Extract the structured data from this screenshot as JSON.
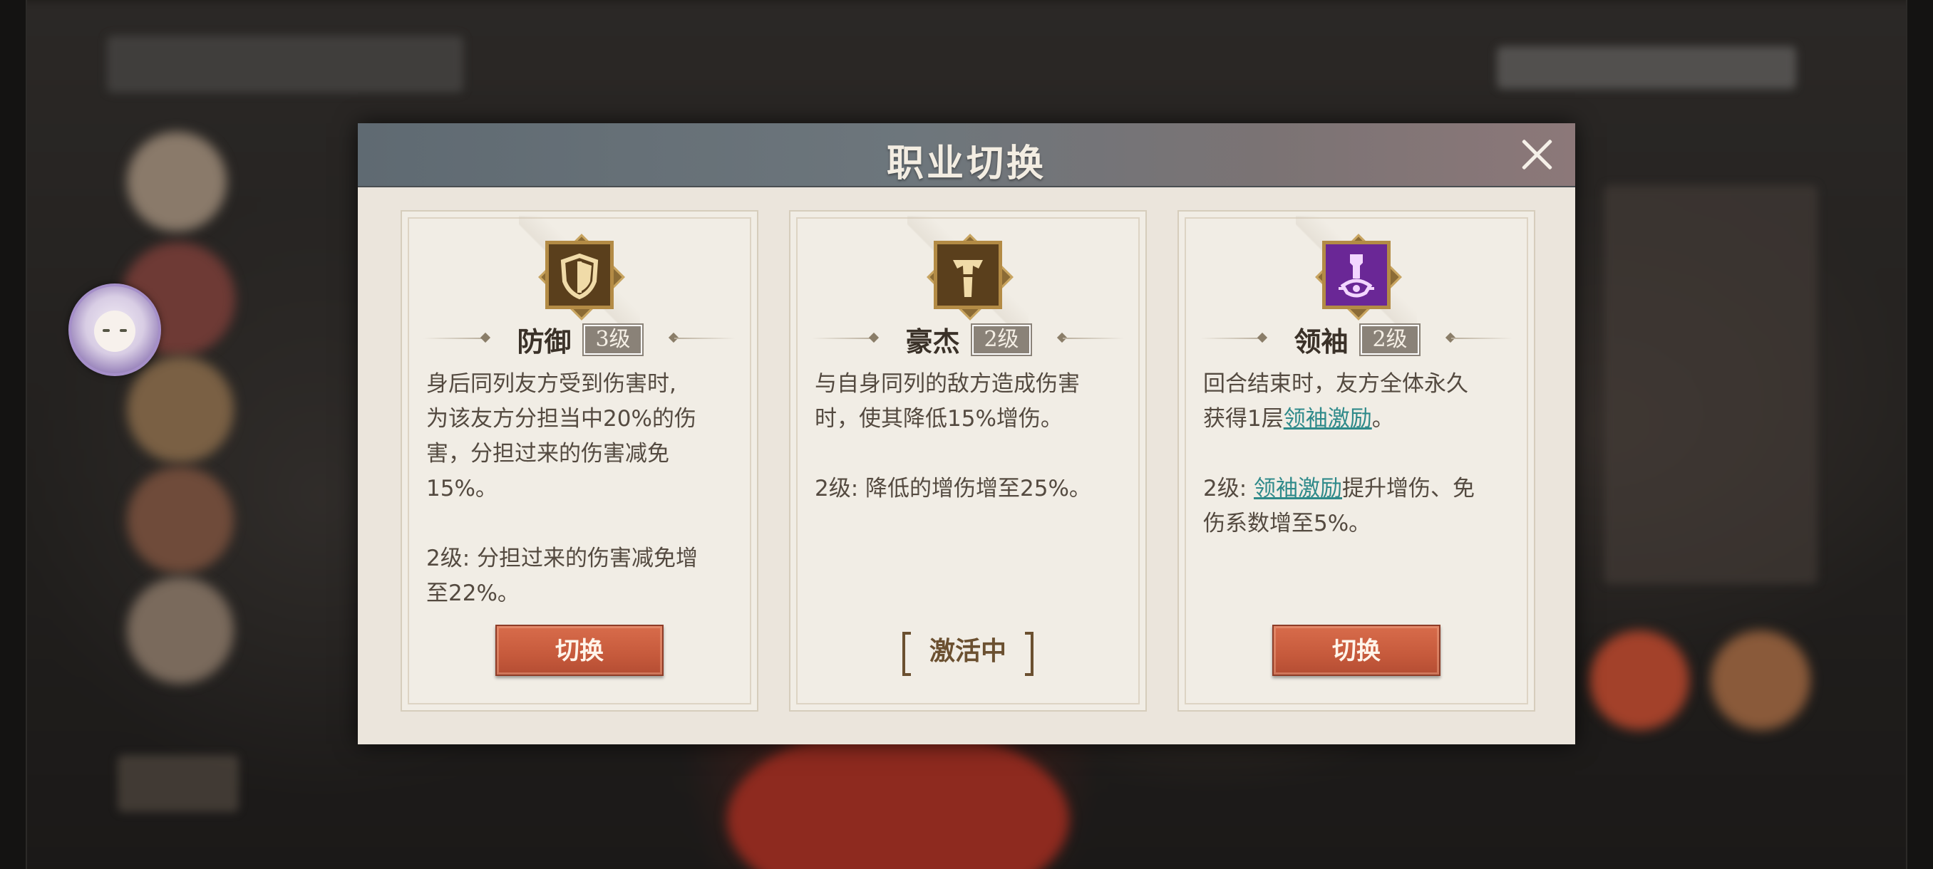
{
  "dialog": {
    "title": "职业切换"
  },
  "cards": [
    {
      "name": "防御",
      "level": "3级",
      "icon": "shield-icon",
      "desc_line1": "身后同列友方受到伤害时,",
      "desc_line2": "为该友方分担当中20%的伤",
      "desc_line3": "害，分担过来的伤害减免",
      "desc_line4": "15%。",
      "upgrade_line1": "2级: 分担过来的伤害减免增",
      "upgrade_line2": "至22%。",
      "button": "切换"
    },
    {
      "name": "豪杰",
      "level": "2级",
      "icon": "banner-icon",
      "desc_line1": "与自身同列的敌方造成伤害",
      "desc_line2": "时，使其降低15%增伤。",
      "upgrade_line1": "2级: 降低的增伤增至25%。",
      "status": "激活中"
    },
    {
      "name": "领袖",
      "level": "2级",
      "icon": "scepter-icon",
      "desc_line1": "回合结束时，友方全体永久",
      "desc_line2_prefix": "获得1层",
      "desc_line2_keyword": "领袖激励",
      "desc_line2_suffix": "。",
      "upgrade_prefix": "2级: ",
      "upgrade_keyword": "领袖激励",
      "upgrade_suffix": "提升增伤、免",
      "upgrade_line2": "伤系数增至5%。",
      "button": "切换"
    }
  ],
  "colors": {
    "accent_button": "#c65a3c",
    "keyword": "#2f8a8a",
    "header": "#6d767c"
  }
}
